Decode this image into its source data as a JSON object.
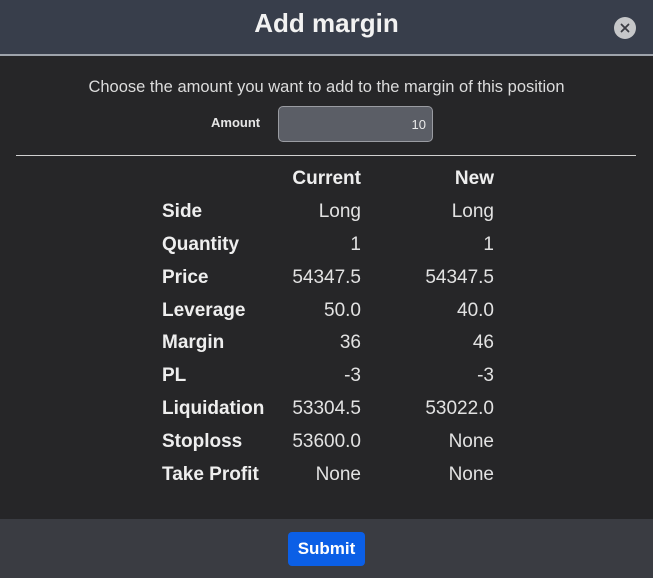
{
  "header": {
    "title": "Add margin",
    "close_icon": "close-icon"
  },
  "form": {
    "instruction": "Choose the amount you want to add to the margin of this position",
    "amount_label": "Amount",
    "amount_value": "10"
  },
  "summary": {
    "headers": {
      "label": "",
      "current": "Current",
      "new": "New"
    },
    "rows": [
      {
        "label": "Side",
        "current": "Long",
        "new": "Long"
      },
      {
        "label": "Quantity",
        "current": "1",
        "new": "1"
      },
      {
        "label": "Price",
        "current": "54347.5",
        "new": "54347.5"
      },
      {
        "label": "Leverage",
        "current": "50.0",
        "new": "40.0"
      },
      {
        "label": "Margin",
        "current": "36",
        "new": "46"
      },
      {
        "label": "PL",
        "current": "-3",
        "new": "-3"
      },
      {
        "label": "Liquidation",
        "current": "53304.5",
        "new": "53022.0"
      },
      {
        "label": "Stoploss",
        "current": "53600.0",
        "new": "None"
      },
      {
        "label": "Take Profit",
        "current": "None",
        "new": "None"
      }
    ]
  },
  "footer": {
    "submit_label": "Submit"
  },
  "colors": {
    "header_bg": "#383e4b",
    "body_bg": "#262628",
    "footer_bg": "#3a3c42",
    "accent": "#0b5fe6"
  }
}
